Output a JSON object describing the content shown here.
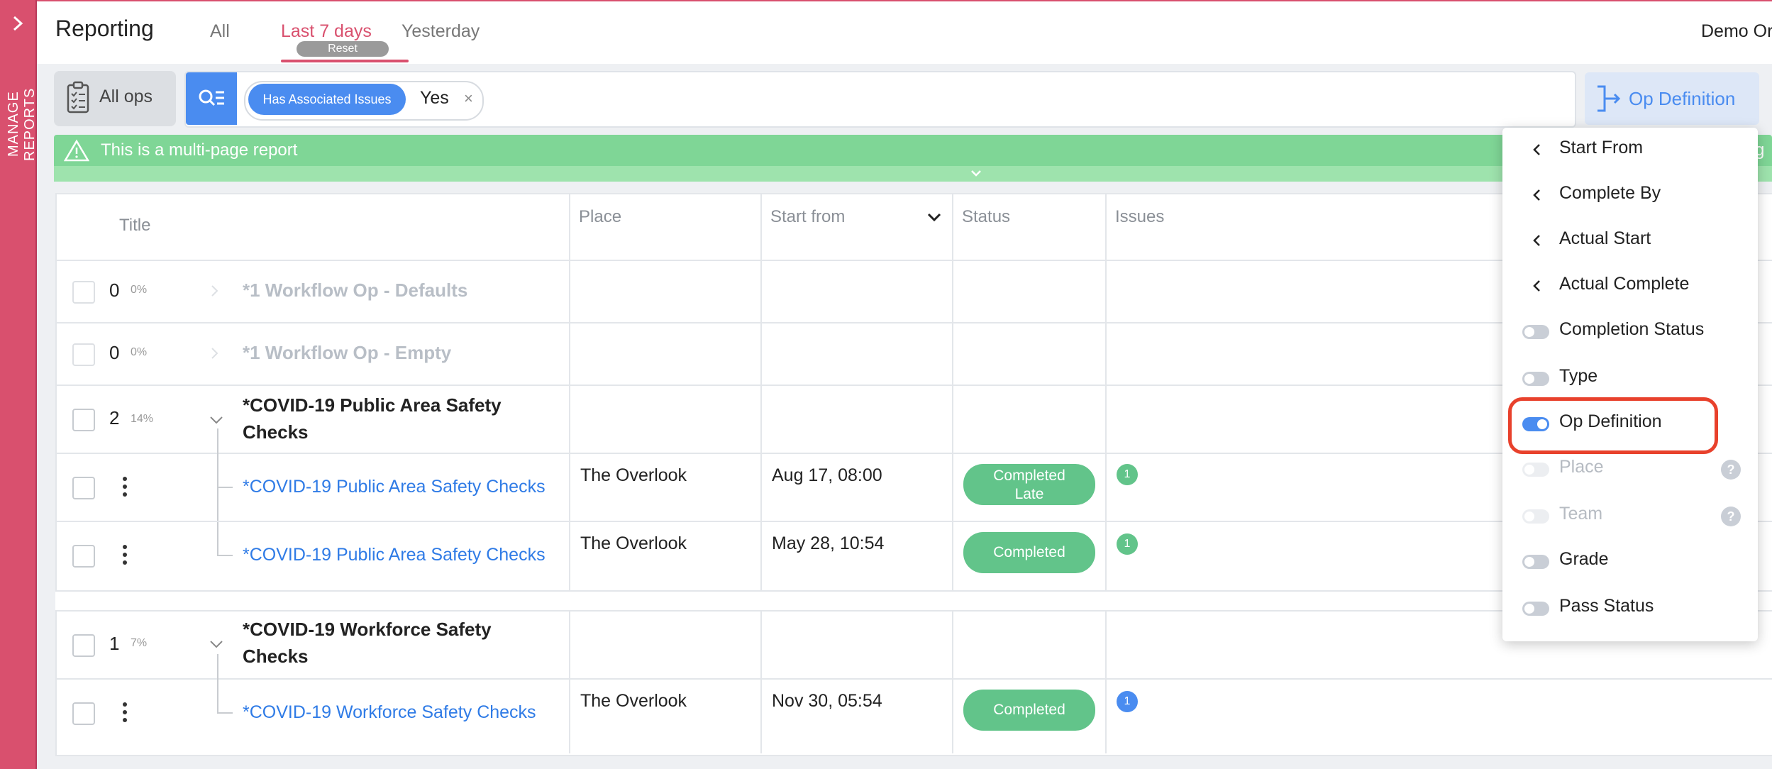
{
  "sidebar": {
    "label": "MANAGE REPORTS"
  },
  "header": {
    "title": "Reporting",
    "tabs": [
      {
        "label": "All"
      },
      {
        "label": "Last 7 days"
      },
      {
        "label": "Yesterday"
      }
    ],
    "reset_label": "Reset",
    "org_name": "Demo Or"
  },
  "toolbar": {
    "all_ops_label": "All ops",
    "filter_chip_label": "Has Associated Issues",
    "filter_chip_value": "Yes",
    "filter_remove": "×",
    "column_button_label": "Op Definition"
  },
  "banner": {
    "text": "This is a multi-page report",
    "edge_text": "g"
  },
  "table": {
    "columns": [
      "Title",
      "Place",
      "Start from",
      "Status",
      "Issues"
    ],
    "rows": [
      {
        "count": "0",
        "pct": "0%",
        "title": "*1 Workflow Op - Defaults"
      },
      {
        "count": "0",
        "pct": "0%",
        "title": "*1 Workflow Op - Empty"
      },
      {
        "count": "2",
        "pct": "14%",
        "title_line1": "*COVID-19 Public Area Safety",
        "title_line2": "Checks"
      },
      {
        "title": "*COVID-19 Public Area Safety Checks",
        "place": "The Overlook",
        "start": "Aug 17, 08:00",
        "status_line1": "Completed",
        "status_line2": "Late",
        "issues": "1"
      },
      {
        "title": "*COVID-19 Public Area Safety Checks",
        "place": "The Overlook",
        "start": "May 28, 10:54",
        "status": "Completed",
        "issues": "1"
      },
      {
        "count": "1",
        "pct": "7%",
        "title_line1": "*COVID-19 Workforce Safety",
        "title_line2": "Checks"
      },
      {
        "title": "*COVID-19 Workforce Safety Checks",
        "place": "The Overlook",
        "start": "Nov 30, 05:54",
        "status": "Completed",
        "issues": "1"
      }
    ]
  },
  "dropdown": {
    "items": [
      {
        "label": "Start From",
        "kind": "chevron"
      },
      {
        "label": "Complete By",
        "kind": "chevron"
      },
      {
        "label": "Actual Start",
        "kind": "chevron"
      },
      {
        "label": "Actual Complete",
        "kind": "chevron"
      },
      {
        "label": "Completion Status",
        "kind": "toggle-off"
      },
      {
        "label": "Type",
        "kind": "toggle-off"
      },
      {
        "label": "Op Definition",
        "kind": "toggle-on"
      },
      {
        "label": "Place",
        "kind": "toggle-disabled",
        "help": "?"
      },
      {
        "label": "Team",
        "kind": "toggle-disabled",
        "help": "?"
      },
      {
        "label": "Grade",
        "kind": "toggle-off"
      },
      {
        "label": "Pass Status",
        "kind": "toggle-off"
      }
    ]
  },
  "colors": {
    "accent": "#d9506e",
    "primary": "#4a8cf0",
    "success": "#62c48a",
    "banner": "#7fd696",
    "highlight": "#e8412c"
  }
}
